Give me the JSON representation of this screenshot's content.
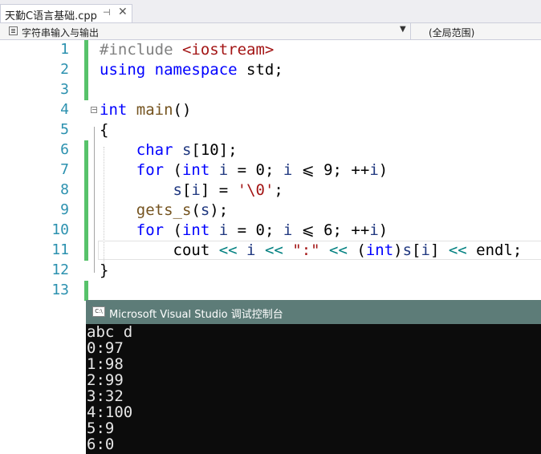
{
  "tab": {
    "title": "天勤C语言基础.cpp",
    "pin_icon": "pin-icon",
    "close_icon": "close-icon"
  },
  "nav": {
    "scope": "字符串输入与输出",
    "global": "(全局范围)"
  },
  "editor": {
    "lines": [
      {
        "n": "1"
      },
      {
        "n": "2"
      },
      {
        "n": "3"
      },
      {
        "n": "4"
      },
      {
        "n": "5"
      },
      {
        "n": "6"
      },
      {
        "n": "7"
      },
      {
        "n": "8"
      },
      {
        "n": "9"
      },
      {
        "n": "10"
      },
      {
        "n": "11"
      },
      {
        "n": "12"
      },
      {
        "n": "13"
      }
    ],
    "code": {
      "l1_a": "#include ",
      "l1_b": "<iostream>",
      "l2_a": "using namespace",
      "l2_b": " std;",
      "l4_a": "int",
      "l4_b": " main",
      "l4_c": "()",
      "l5": "{",
      "l6_a": "    char",
      "l6_b": " s",
      "l6_c": "[10];",
      "l7_a": "    for",
      "l7_b": " (",
      "l7_c": "int",
      "l7_d": " i",
      "l7_e": " = 0; ",
      "l7_f": "i",
      "l7_g": " ⩽ ",
      "l7_h": "9; ",
      "l7_i": "++",
      "l7_j": "i",
      "l7_k": ")",
      "l8_a": "        s",
      "l8_b": "[",
      "l8_c": "i",
      "l8_d": "] = ",
      "l8_e": "'\\0'",
      "l8_f": ";",
      "l9_a": "    gets_s",
      "l9_b": "(",
      "l9_c": "s",
      "l9_d": ");",
      "l10_a": "    for",
      "l10_b": " (",
      "l10_c": "int",
      "l10_d": " i",
      "l10_e": " = 0; ",
      "l10_f": "i",
      "l10_g": " ⩽ ",
      "l10_h": "6; ",
      "l10_i": "++",
      "l10_j": "i",
      "l10_k": ")",
      "l11_a": "        cout",
      "l11_b": " << ",
      "l11_c": "i",
      "l11_d": " << ",
      "l11_e": "\":\"",
      "l11_f": " << ",
      "l11_g": "(",
      "l11_h": "int",
      "l11_i": ")",
      "l11_j": "s",
      "l11_k": "[",
      "l11_l": "i",
      "l11_m": "] ",
      "l11_n": "<<",
      "l11_o": " endl;",
      "l12": "}"
    }
  },
  "console": {
    "title": "Microsoft Visual Studio 调试控制台",
    "icon_text": "C:\\",
    "output": [
      "abc d",
      "0:97",
      "1:98",
      "2:99",
      "3:32",
      "4:100",
      "5:9",
      "6:0"
    ]
  },
  "colors": {
    "line_numbers": "#2b91af",
    "change_marker": "#57c26a",
    "console_title_bg": "#5d7c78",
    "console_bg": "#0c0c0c"
  }
}
